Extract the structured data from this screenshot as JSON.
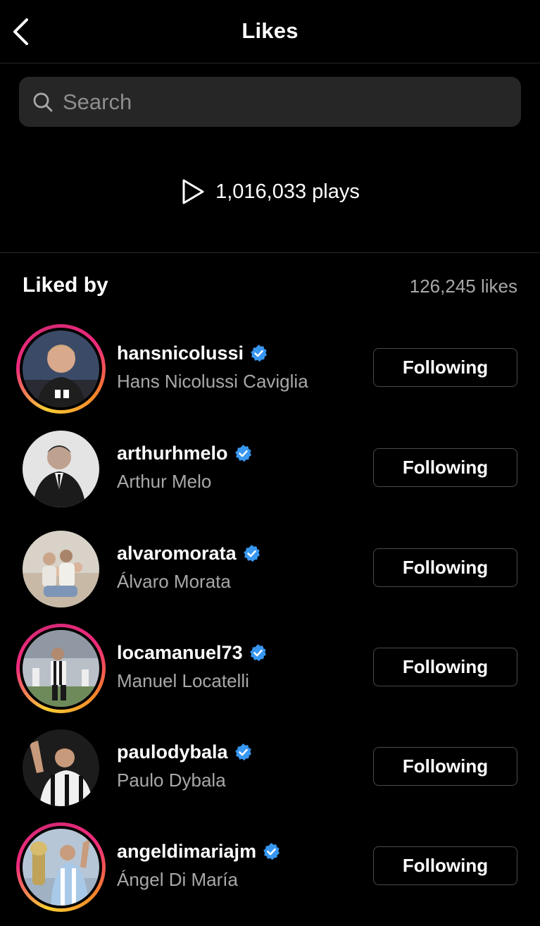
{
  "header": {
    "title": "Likes",
    "back_icon": "chevron-left-icon"
  },
  "search": {
    "placeholder": "Search",
    "value": "",
    "icon": "search-icon"
  },
  "plays": {
    "icon": "play-icon",
    "label": "1,016,033 plays"
  },
  "liked_by": {
    "heading": "Liked by",
    "count": "126,245 likes"
  },
  "colors": {
    "background": "#000000",
    "search_bg": "#262626",
    "secondary_text": "#a8a8a8",
    "verified_blue": "#3897f0",
    "button_border": "#4a4a4a"
  },
  "users": [
    {
      "username": "hansnicolussi",
      "fullname": "Hans Nicolussi Caviglia",
      "verified": true,
      "story_ring": true,
      "button": "Following"
    },
    {
      "username": "arthurhmelo",
      "fullname": "Arthur Melo",
      "verified": true,
      "story_ring": false,
      "button": "Following"
    },
    {
      "username": "alvaromorata",
      "fullname": "Álvaro Morata",
      "verified": true,
      "story_ring": false,
      "button": "Following"
    },
    {
      "username": "locamanuel73",
      "fullname": "Manuel Locatelli",
      "verified": true,
      "story_ring": true,
      "button": "Following"
    },
    {
      "username": "paulodybala",
      "fullname": "Paulo Dybala",
      "verified": true,
      "story_ring": false,
      "button": "Following"
    },
    {
      "username": "angeldimariajm",
      "fullname": "Ángel Di María",
      "verified": true,
      "story_ring": true,
      "button": "Following"
    }
  ]
}
